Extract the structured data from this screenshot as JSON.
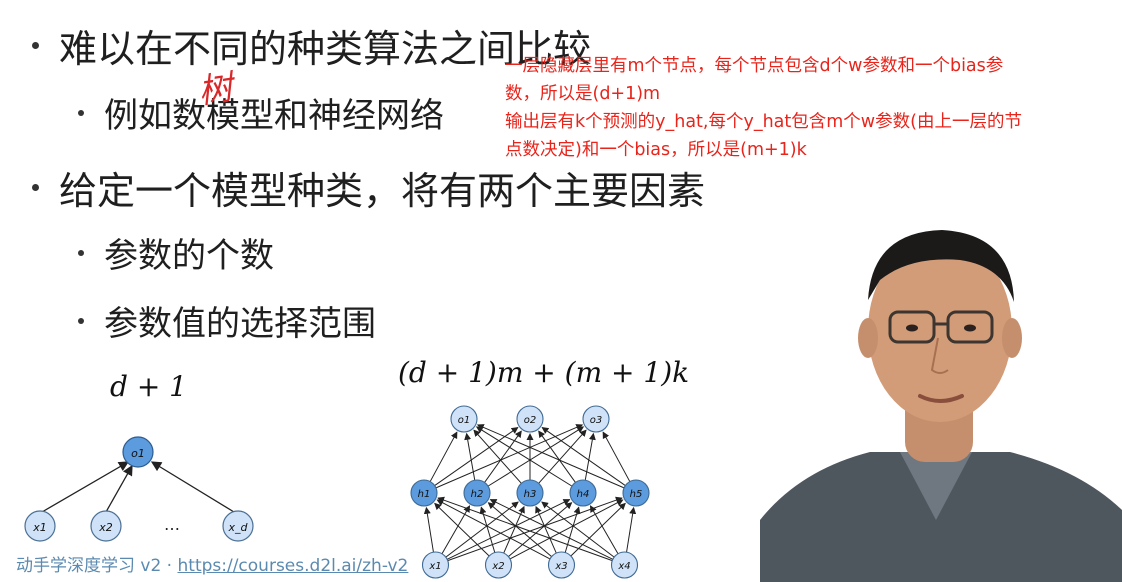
{
  "slide": {
    "bullets": [
      {
        "level": 1,
        "text": "难以在不同的种类算法之间比较"
      },
      {
        "level": 2,
        "text": "例如数模型和神经网络"
      },
      {
        "level": 1,
        "text": "给定一个模型种类，将有两个主要因素"
      },
      {
        "level": 2,
        "text": "参数的个数"
      },
      {
        "level": 2,
        "text": "参数值的选择范围"
      }
    ],
    "handwritten_note": "树",
    "formula_left": "d + 1",
    "formula_right": "(d + 1)m + (m + 1)k"
  },
  "annotation": {
    "lines": [
      "一层隐藏层里有m个节点，每个节点包含d个w参数和一个bias参",
      "数，所以是(d+1)m",
      "输出层有k个预测的y_hat,每个y_hat包含m个w参数(由上一层的节",
      "点数决定)和一个bias，所以是(m+1)k"
    ]
  },
  "diagram_left": {
    "output": "o1",
    "inputs": [
      "x1",
      "x2",
      "x_d"
    ],
    "ellipsis": "…"
  },
  "diagram_right": {
    "outputs": [
      "o1",
      "o2",
      "o3"
    ],
    "hidden": [
      "h1",
      "h2",
      "h3",
      "h4",
      "h5"
    ],
    "inputs": [
      "x1",
      "x2",
      "x3",
      "x4"
    ]
  },
  "footer": {
    "course": "动手学深度学习 v2 · ",
    "url": "https://courses.d2l.ai/zh-v2"
  },
  "colors": {
    "annotation": "#e8241b",
    "node_light": "#cfe2f7",
    "node_dark": "#5b9bde",
    "footer": "#5b8ab0"
  }
}
